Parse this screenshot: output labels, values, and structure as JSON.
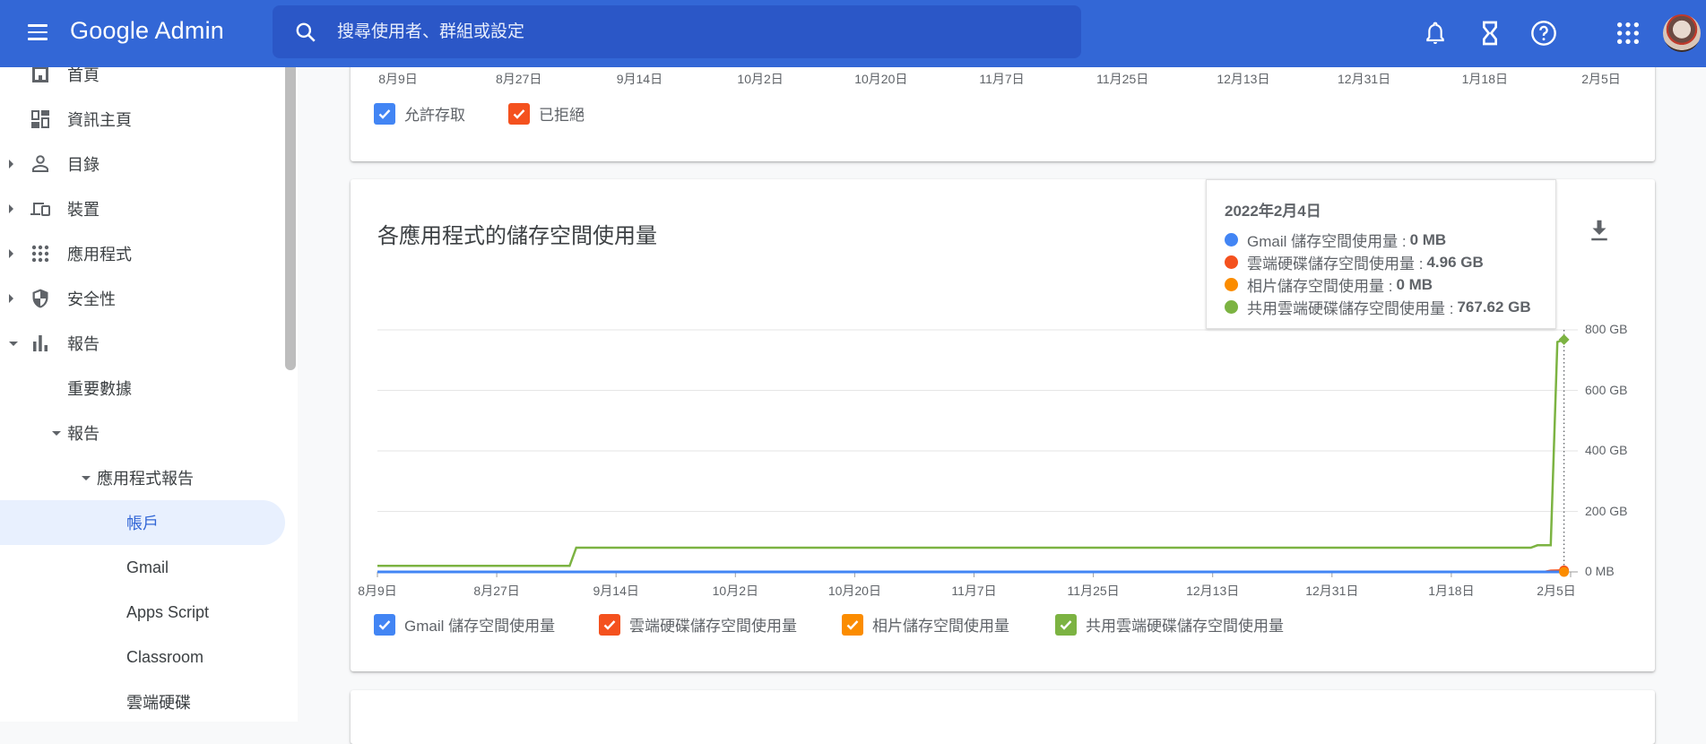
{
  "header": {
    "app_title": "Google Admin",
    "search_placeholder": "搜尋使用者、群組或設定",
    "icons": [
      "menu-icon",
      "search-icon",
      "bell-icon",
      "hourglass-icon",
      "help-icon",
      "apps-grid-icon",
      "avatar"
    ]
  },
  "sidebar": {
    "items": [
      {
        "label": "首頁",
        "icon": "home-icon",
        "caret": "none"
      },
      {
        "label": "資訊主頁",
        "icon": "dashboard-icon",
        "caret": "none"
      },
      {
        "label": "目錄",
        "icon": "person-icon",
        "caret": "right"
      },
      {
        "label": "裝置",
        "icon": "devices-icon",
        "caret": "right"
      },
      {
        "label": "應用程式",
        "icon": "apps-icon",
        "caret": "right"
      },
      {
        "label": "安全性",
        "icon": "shield-icon",
        "caret": "right"
      },
      {
        "label": "報告",
        "icon": "bar-chart-icon",
        "caret": "down"
      },
      {
        "label": "重要數據",
        "caret": "none"
      },
      {
        "label": "報告",
        "caret": "down"
      },
      {
        "label": "應用程式報告",
        "caret": "down"
      },
      {
        "label": "帳戶",
        "active": true
      },
      {
        "label": "Gmail"
      },
      {
        "label": "Apps Script"
      },
      {
        "label": "Classroom"
      },
      {
        "label": "雲端硬碟"
      }
    ]
  },
  "top_card": {
    "x_ticks": [
      "8月9日",
      "8月27日",
      "9月14日",
      "10月2日",
      "10月20日",
      "11月7日",
      "11月25日",
      "12月13日",
      "12月31日",
      "1月18日",
      "2月5日"
    ],
    "legend": [
      {
        "label": "允許存取",
        "color": "#4285f4",
        "checked": true
      },
      {
        "label": "已拒絕",
        "color": "#f4511e",
        "checked": true
      }
    ]
  },
  "storage_card": {
    "title": "各應用程式的儲存空間使用量",
    "download_icon": "download-icon",
    "tooltip": {
      "date": "2022年2月4日",
      "rows": [
        {
          "label": "Gmail 儲存空間使用量 :",
          "value": "0 MB",
          "color": "#4285f4"
        },
        {
          "label": "雲端硬碟儲存空間使用量 :",
          "value": "4.96 GB",
          "color": "#f4511e"
        },
        {
          "label": "相片儲存空間使用量 :",
          "value": "0 MB",
          "color": "#fb8c00"
        },
        {
          "label": "共用雲端硬碟儲存空間使用量 :",
          "value": "767.62 GB",
          "color": "#7cb342"
        }
      ]
    }
  },
  "chart_data": {
    "type": "line",
    "title": "各應用程式的儲存空間使用量",
    "xlabel": "",
    "ylabel": "",
    "x_tick_labels": [
      "8月9日",
      "8月27日",
      "9月14日",
      "10月2日",
      "10月20日",
      "11月7日",
      "11月25日",
      "12月13日",
      "12月31日",
      "1月18日",
      "2月5日"
    ],
    "y_tick_labels": [
      "0 MB",
      "200 GB",
      "400 GB",
      "600 GB",
      "800 GB"
    ],
    "y_ticks_gb": [
      0,
      200,
      400,
      600,
      800
    ],
    "ylim_gb": [
      0,
      800
    ],
    "x_range_days": [
      0,
      180
    ],
    "grid": true,
    "legend_position": "bottom",
    "hover_day": 179,
    "series": [
      {
        "name": "Gmail 儲存空間使用量",
        "color": "#4285f4",
        "checked": true,
        "points_day_gb": [
          [
            0,
            0
          ],
          [
            179,
            0
          ]
        ]
      },
      {
        "name": "雲端硬碟儲存空間使用量",
        "color": "#f4511e",
        "checked": true,
        "points_day_gb": [
          [
            0,
            0
          ],
          [
            176,
            0
          ],
          [
            177,
            4
          ],
          [
            179,
            4.96
          ]
        ]
      },
      {
        "name": "相片儲存空間使用量",
        "color": "#fb8c00",
        "checked": true,
        "points_day_gb": [
          [
            0,
            0
          ],
          [
            179,
            0
          ]
        ]
      },
      {
        "name": "共用雲端硬碟儲存空間使用量",
        "color": "#7cb342",
        "checked": true,
        "points_day_gb": [
          [
            0,
            20
          ],
          [
            29,
            20
          ],
          [
            30,
            80
          ],
          [
            174,
            80
          ],
          [
            175,
            88
          ],
          [
            177,
            88
          ],
          [
            178,
            760
          ],
          [
            179,
            767.62
          ]
        ]
      }
    ]
  }
}
